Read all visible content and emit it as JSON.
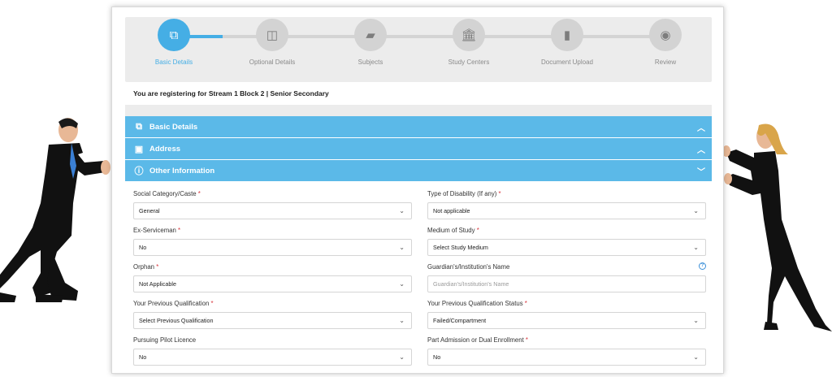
{
  "stepper": {
    "steps": [
      {
        "label": "Basic Details",
        "icon": "copy-icon",
        "glyph": "⧉",
        "active": true
      },
      {
        "label": "Optional Details",
        "icon": "columns-icon",
        "glyph": "◫",
        "active": false
      },
      {
        "label": "Subjects",
        "icon": "book-icon",
        "glyph": "▰",
        "active": false
      },
      {
        "label": "Study Centers",
        "icon": "institution-icon",
        "glyph": "🏛",
        "active": false
      },
      {
        "label": "Document Upload",
        "icon": "document-icon",
        "glyph": "▮",
        "active": false
      },
      {
        "label": "Review",
        "icon": "eye-icon",
        "glyph": "◉",
        "active": false
      }
    ]
  },
  "stream_text": "You are registering for Stream 1 Block 2 | Senior Secondary",
  "accordion": {
    "basic_details": "Basic Details",
    "address": "Address",
    "other_information": "Other Information"
  },
  "form": {
    "social_category": {
      "label": "Social Category/Caste",
      "value": "General"
    },
    "disability": {
      "label": "Type of Disability (If any)",
      "value": "Not applicable"
    },
    "ex_serviceman": {
      "label": "Ex-Serviceman",
      "value": "No"
    },
    "medium": {
      "label": "Medium of Study",
      "value": "Select Study Medium"
    },
    "orphan": {
      "label": "Orphan",
      "value": "Not Applicable"
    },
    "guardian": {
      "label": "Guardian's/Institution's Name",
      "placeholder": "Guardian's/Institution's Name"
    },
    "prev_qual": {
      "label": "Your Previous Qualification",
      "value": "Select Previous Qualification"
    },
    "prev_qual_status": {
      "label": "Your Previous Qualification Status",
      "value": "Failed/Compartment"
    },
    "pilot": {
      "label": "Pursuing Pilot Licence",
      "value": "No"
    },
    "part_admission": {
      "label": "Part Admission or Dual Enrollment",
      "value": "No"
    }
  },
  "colors": {
    "accent": "#45aee5",
    "accordion": "#5bb9e8",
    "required": "#d9363e"
  }
}
